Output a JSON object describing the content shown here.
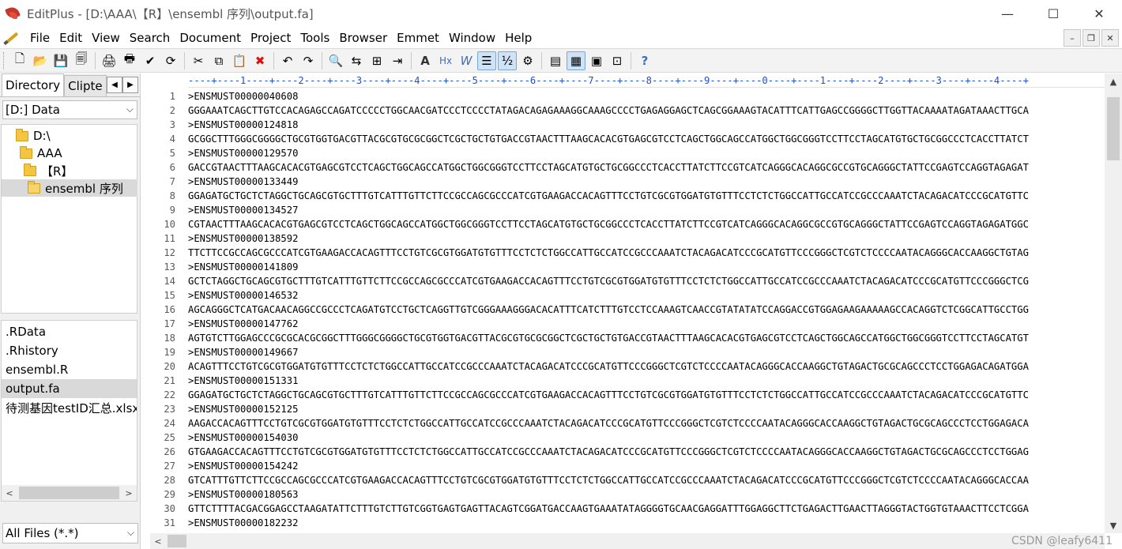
{
  "window": {
    "title": "EditPlus - [D:\\AAA\\【R】\\ensembl 序列\\output.fa]",
    "controls": {
      "minimize": "—",
      "maximize": "☐",
      "close": "✕"
    }
  },
  "menu": {
    "items": [
      "File",
      "Edit",
      "View",
      "Search",
      "Document",
      "Project",
      "Tools",
      "Browser",
      "Emmet",
      "Window",
      "Help"
    ],
    "mdi": {
      "minimize": "–",
      "restore": "❐",
      "close": "✕"
    }
  },
  "toolbar": {
    "glyphs": {
      "new": "🗋",
      "open": "📂",
      "save": "💾",
      "save_all": "🗐",
      "print_preview": "🖨",
      "print": "🖶",
      "spell": "✔",
      "browser": "⟳",
      "cut": "✂",
      "copy": "⧉",
      "paste": "📋",
      "delete": "✖",
      "undo": "↶",
      "redo": "↷",
      "find": "🔍",
      "replace": "⇆",
      "find_in_files": "⊞",
      "goto": "⇥",
      "font": "A",
      "hex": "Hx",
      "word_wrap": "W",
      "line_wrap": "☰",
      "line_numbers": "½",
      "settings": "⚙",
      "directory": "▤",
      "cliptext": "▦",
      "output": "▣",
      "screen": "⊡",
      "help": "?"
    }
  },
  "left_panel": {
    "tabs": [
      "Directory",
      "Clipte"
    ],
    "arrows": {
      "left": "◀",
      "right": "▶"
    },
    "drive": "[D:] Data",
    "dropdown_arrow": "⌵",
    "tree": [
      {
        "label": "D:\\",
        "level": 0
      },
      {
        "label": "AAA",
        "level": 1
      },
      {
        "label": "【R】",
        "level": 2
      },
      {
        "label": "ensembl 序列",
        "level": 3,
        "selected": true
      }
    ],
    "files": [
      {
        "name": ".RData"
      },
      {
        "name": ".Rhistory"
      },
      {
        "name": "ensembl.R"
      },
      {
        "name": "output.fa",
        "selected": true
      },
      {
        "name": "待测基因testID汇总.xlsx"
      }
    ],
    "scroll_arrows": {
      "left": "<",
      "right": ">"
    },
    "filter": "All Files (*.*)"
  },
  "editor": {
    "ruler": "----+----1----+----2----+----3----+----4----+----5----+----6----+----7----+----8----+----9----+----0----+----1----+----2----+----3----+----4----+",
    "lines": [
      ">ENSMUST00000040608",
      "GGGAAATCAGCTTGTCCACAGAGCCAGATCCCCCTGGCAACGATCCCTCCCCTATAGACAGAGAAAGGCAAAGCCCCTGAGAGGAGCTCAGCGGAAAGTACATTTCATTGAGCCGGGGCTTGGTTACAAAATAGATAAACTTGCA",
      ">ENSMUST00000124818",
      "GCGGCTTTGGGCGGGGCTGCGTGGTGACGTTACGCGTGCGCGGCTCGCTGCTGTGACCGTAACTTTAAGCACACGTGAGCGTCCTCAGCTGGCAGCCATGGCTGGCGGGTCCTTCCTAGCATGTGCTGCGGCCCTCACCTTATCT",
      ">ENSMUST00000129570",
      "GACCGTAACTTTAAGCACACGTGAGCGTCCTCAGCTGGCAGCCATGGCTGGCGGGTCCTTCCTAGCATGTGCTGCGGCCCTCACCTTATCTTCCGTCATCAGGGCACAGGCGCCGTGCAGGGCTATTCCGAGTCCAGGTAGAGAT",
      ">ENSMUST00000133449",
      "GGAGATGCTGCTCTAGGCTGCAGCGTGCTTTGTCATTTGTTCTTCCGCCAGCGCCCATCGTGAAGACCACAGTTTCCTGTCGCGTGGATGTGTTTCCTCTCTGGCCATTGCCATCCGCCCAAATCTACAGACATCCCGCATGTTC",
      ">ENSMUST00000134527",
      "CGTAACTTTAAGCACACGTGAGCGTCCTCAGCTGGCAGCCATGGCTGGCGGGTCCTTCCTAGCATGTGCTGCGGCCCTCACCTTATCTTCCGTCATCAGGGCACAGGCGCCGTGCAGGGCTATTCCGAGTCCAGGTAGAGATGGC",
      ">ENSMUST00000138592",
      "TTCTTCCGCCAGCGCCCATCGTGAAGACCACAGTTTCCTGTCGCGTGGATGTGTTTCCTCTCTGGCCATTGCCATCCGCCCAAATCTACAGACATCCCGCATGTTCCCGGGCTCGTCTCCCCAATACAGGGCACCAAGGCTGTAG",
      ">ENSMUST00000141809",
      "GCTCTAGGCTGCAGCGTGCTTTGTCATTTGTTCTTCCGCCAGCGCCCATCGTGAAGACCACAGTTTCCTGTCGCGTGGATGTGTTTCCTCTCTGGCCATTGCCATCCGCCCAAATCTACAGACATCCCGCATGTTCCCGGGCTCG",
      ">ENSMUST00000146532",
      "AGCAGGGCTCATGACAACAGGCCGCCCTCAGATGTCCTGCTCAGGTTGTCGGGAAAGGGACACATTTCATCTTTGTCCTCCAAAGTCAACCGTATATATCCAGGACCGTGGAGAAGAAAAAGCCACAGGTCTCGGCATTGCCTGG",
      ">ENSMUST00000147762",
      "AGTGTCTTGGAGCCCGCGCACGCGGCTTTGGGCGGGGCTGCGTGGTGACGTTACGCGTGCGCGGCTCGCTGCTGTGACCGTAACTTTAAGCACACGTGAGCGTCCTCAGCTGGCAGCCATGGCTGGCGGGTCCTTCCTAGCATGT",
      ">ENSMUST00000149667",
      "ACAGTTTCCTGTCGCGTGGATGTGTTTCCTCTCTGGCCATTGCCATCCGCCCAAATCTACAGACATCCCGCATGTTCCCGGGCTCGTCTCCCCAATACAGGGCACCAAGGCTGTAGACTGCGCAGCCCTCCTGGAGACAGATGGA",
      ">ENSMUST00000151331",
      "GGAGATGCTGCTCTAGGCTGCAGCGTGCTTTGTCATTTGTTCTTCCGCCAGCGCCCATCGTGAAGACCACAGTTTCCTGTCGCGTGGATGTGTTTCCTCTCTGGCCATTGCCATCCGCCCAAATCTACAGACATCCCGCATGTTC",
      ">ENSMUST00000152125",
      "AAGACCACAGTTTCCTGTCGCGTGGATGTGTTTCCTCTCTGGCCATTGCCATCCGCCCAAATCTACAGACATCCCGCATGTTCCCGGGCTCGTCTCCCCAATACAGGGCACCAAGGCTGTAGACTGCGCAGCCCTCCTGGAGACA",
      ">ENSMUST00000154030",
      "GTGAAGACCACAGTTTCCTGTCGCGTGGATGTGTTTCCTCTCTGGCCATTGCCATCCGCCCAAATCTACAGACATCCCGCATGTTCCCGGGCTCGTCTCCCCAATACAGGGCACCAAGGCTGTAGACTGCGCAGCCCTCCTGGAG",
      ">ENSMUST00000154242",
      "GTCATTTGTTCTTCCGCCAGCGCCCATCGTGAAGACCACAGTTTCCTGTCGCGTGGATGTGTTTCCTCTCTGGCCATTGCCATCCGCCCAAATCTACAGACATCCCGCATGTTCCCGGGCTCGTCTCCCCAATACAGGGCACCAA",
      ">ENSMUST00000180563",
      "GTTCTTTTACGACGGAGCCTAAGATATTCTTTGTCTTGTCGGTGAGTGAGTTACAGTCGGATGACCAAGTGAAATATAGGGGTGCAACGAGGATTTGGAGGCTTCTGAGACTTGAACTTAGGGTACTGGTGTAAACTTCCTCGGA",
      ">ENSMUST00000182232"
    ],
    "line_numbers": [
      "1",
      "2",
      "3",
      "4",
      "5",
      "6",
      "7",
      "8",
      "9",
      "10",
      "11",
      "12",
      "13",
      "14",
      "15",
      "16",
      "17",
      "18",
      "19",
      "20",
      "21",
      "22",
      "23",
      "24",
      "25",
      "26",
      "27",
      "28",
      "29",
      "30",
      "31"
    ],
    "scroll_arrows": {
      "up": "▲",
      "down": "▼",
      "left": "<",
      "right": ">"
    }
  },
  "watermark": "CSDN @leafy6411"
}
